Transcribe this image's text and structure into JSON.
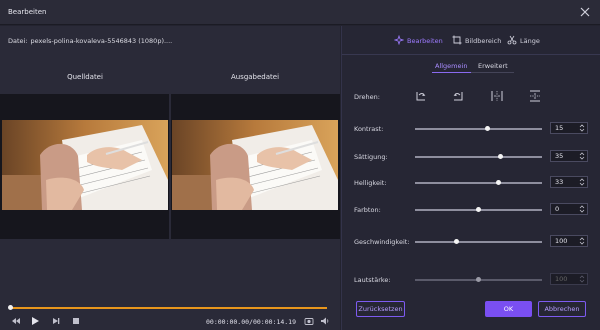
{
  "window": {
    "title": "Bearbeiten"
  },
  "file": {
    "label": "Datei:",
    "name": "pexels-polina-kovaleva-5546843 (1080p)...."
  },
  "preview": {
    "source_label": "Quelldatei",
    "output_label": "Ausgabedatei"
  },
  "player": {
    "timecode": "00:00:00.00/00:00:14.19",
    "progress": 0.0
  },
  "tabs": [
    {
      "label": "Bearbeiten",
      "icon": "magic-wand-icon",
      "active": true
    },
    {
      "label": "Bildbereich",
      "icon": "crop-icon",
      "active": false
    },
    {
      "label": "Länge",
      "icon": "scissors-icon",
      "active": false
    }
  ],
  "subtabs": [
    {
      "label": "Allgemein",
      "active": true
    },
    {
      "label": "Erweitert",
      "active": false
    }
  ],
  "rotate": {
    "label": "Drehen:"
  },
  "settings": [
    {
      "label": "Kontrast:",
      "value": "15",
      "level": 0.57
    },
    {
      "label": "Sättigung:",
      "value": "35",
      "level": 0.67
    },
    {
      "label": "Helligkeit:",
      "value": "33",
      "level": 0.66
    },
    {
      "label": "Farbton:",
      "value": "0",
      "level": 0.5
    },
    {
      "label": "Geschwindigkeit:",
      "value": "100",
      "level": 0.33
    },
    {
      "label": "Lautstärke:",
      "value": "100",
      "level": 0.5,
      "disabled": true
    }
  ],
  "buttons": {
    "reset": "Zurücksetzen",
    "ok": "OK",
    "cancel": "Abbrechen"
  },
  "colors": {
    "accent": "#7a4ff2",
    "progress": "#e8961c",
    "background": "#23232f"
  }
}
